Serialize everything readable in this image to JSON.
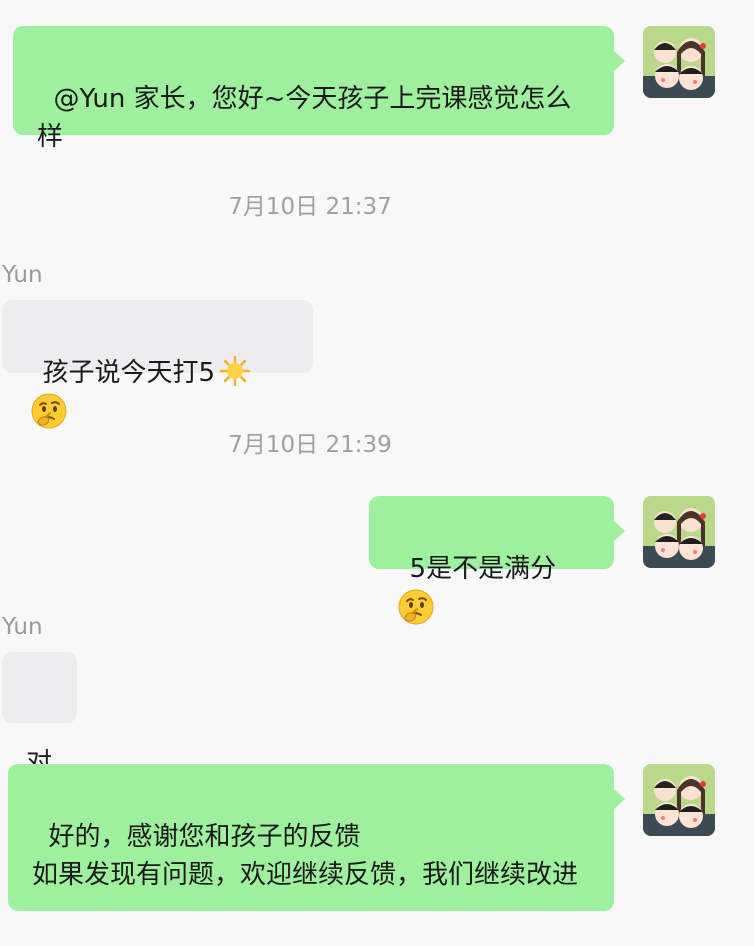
{
  "messages": [
    {
      "text": "@Yun 家长，您好~今天孩子上完课感觉怎么样"
    },
    {
      "sender": "Yun",
      "text": "孩子说今天打5"
    },
    {
      "text": "5是不是满分"
    },
    {
      "sender": "Yun",
      "text": "对"
    },
    {
      "text": "好的，感谢您和孩子的反馈\n如果发现有问题，欢迎继续反馈，我们继续改进"
    }
  ],
  "timestamps": [
    "7月10日 21:37",
    "7月10日 21:39"
  ],
  "icons": {
    "sun": "sun-emoji",
    "thinking": "thinking-face-emoji",
    "avatar": "family-cartoon-avatar"
  },
  "colors": {
    "outgoing_bubble": "#9ef09f",
    "incoming_bubble": "#ededf0",
    "background": "#f8f8f8",
    "avatar_bg": "#b9d889"
  }
}
